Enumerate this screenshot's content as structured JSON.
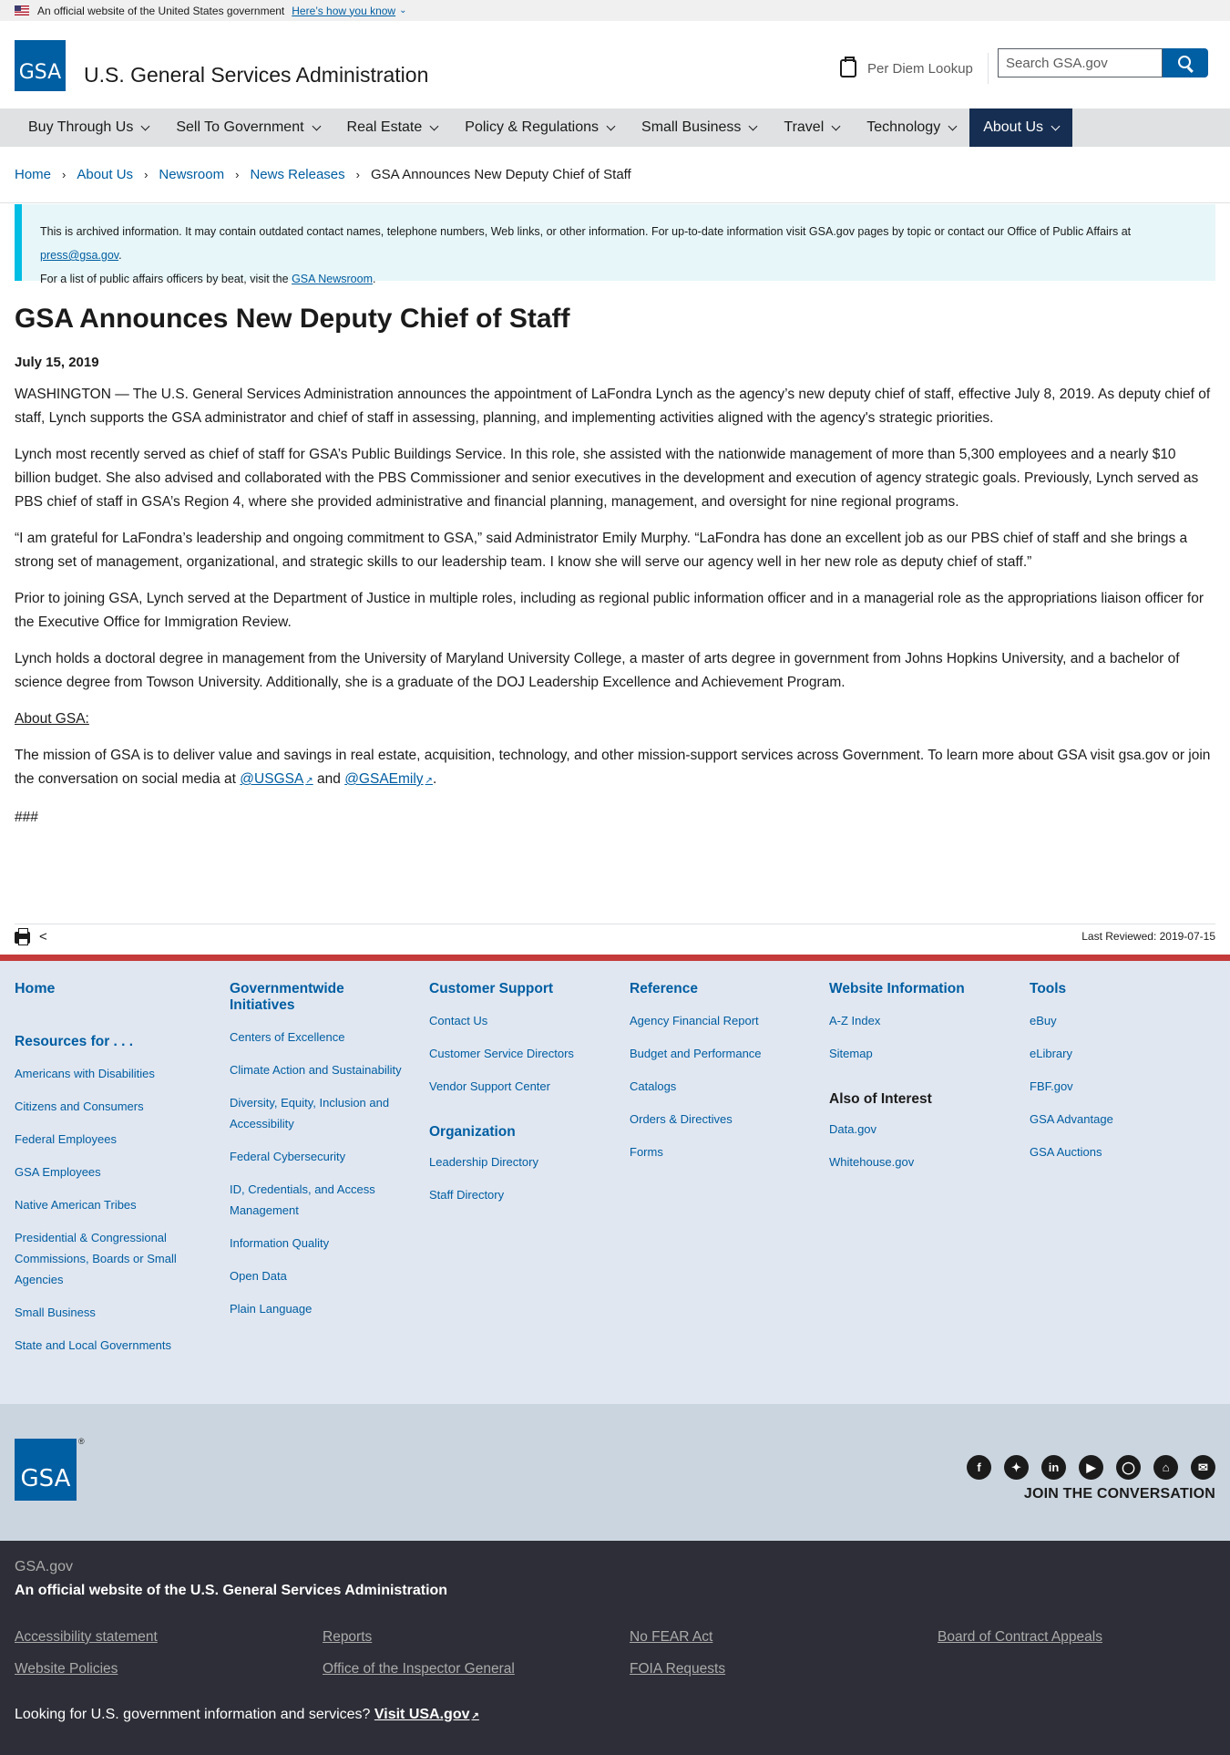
{
  "banner": {
    "text": "An official website of the United States government",
    "link": "Here’s how you know"
  },
  "header": {
    "logo": "GSA",
    "title": "U.S. General Services Administration",
    "per_diem": "Per Diem Lookup",
    "search_placeholder": "Search GSA.gov"
  },
  "nav": [
    {
      "label": "Buy Through Us"
    },
    {
      "label": "Sell To Government"
    },
    {
      "label": "Real Estate"
    },
    {
      "label": "Policy & Regulations"
    },
    {
      "label": "Small Business"
    },
    {
      "label": "Travel"
    },
    {
      "label": "Technology"
    },
    {
      "label": "About Us"
    }
  ],
  "breadcrumb": [
    "Home",
    "About Us",
    "Newsroom",
    "News Releases",
    "GSA Announces New Deputy Chief of Staff"
  ],
  "alert": {
    "line1": "This is archived information. It may contain outdated contact names, telephone numbers, Web links, or other information. For up-to-date information visit GSA.gov pages by topic or contact our Office of Public Affairs at",
    "email": "press@gsa.gov",
    "line2": "For a list of public affairs officers by beat, visit the",
    "newsroom": "GSA Newsroom"
  },
  "article": {
    "title": "GSA Announces New Deputy Chief of Staff",
    "date": "July 15, 2019",
    "p1": "WASHINGTON — The U.S. General Services Administration announces the appointment of LaFondra Lynch as the agency’s new deputy chief of staff, effective July 8, 2019. As deputy chief of staff, Lynch supports the GSA administrator and chief of staff in assessing, planning, and implementing activities aligned with the agency's strategic priorities.",
    "p2": "Lynch most recently served as chief of staff for GSA’s Public Buildings Service. In this role, she assisted with the nationwide management of more than 5,300 employees and a nearly $10 billion budget. She also advised and collaborated with the PBS Commissioner and senior executives in the development and execution of agency strategic goals. Previously, Lynch served as PBS chief of staff in GSA’s Region 4, where she provided administrative and financial planning, management, and oversight for nine regional programs.",
    "p3": "“I am grateful for LaFondra’s leadership and ongoing commitment to GSA,” said Administrator Emily Murphy. “LaFondra has done an excellent job as our PBS chief of staff and she brings a strong set of management, organizational, and strategic skills to our leadership team. I know she will serve our agency well in her new role as deputy chief of staff.”",
    "p4": "Prior to joining GSA, Lynch served at the Department of Justice in multiple roles, including as regional public information officer and in a managerial role as the appropriations liaison officer for the Executive Office for Immigration Review.",
    "p5": "Lynch holds a doctoral degree in management from the University of Maryland University College, a master of arts degree in government from Johns Hopkins University, and a bachelor of science degree from Towson University. Additionally, she is a graduate of the DOJ Leadership Excellence and Achievement Program.",
    "about_heading": "About GSA:",
    "p6_pre": "The mission of GSA is to deliver value and savings in real estate, acquisition, technology, and other mission-support services across Government. To learn more about GSA visit gsa.gov or join the conversation on social media at",
    "link_usgsa": "@USGSA",
    "and": "and",
    "link_gsaemily": "@GSAEmily",
    "end_mark": "###"
  },
  "page_tools": {
    "last_reviewed": "Last Reviewed: 2019-07-15"
  },
  "footer": {
    "home": "Home",
    "resources_heading": "Resources for . . .",
    "resources": [
      "Americans with Disabilities",
      "Citizens and Consumers",
      "Federal Employees",
      "GSA Employees",
      "Native American Tribes",
      "Presidential & Congressional Commissions, Boards or Small Agencies",
      "Small Business",
      "State and Local Governments"
    ],
    "governmentwide_heading": "Governmentwide Initiatives",
    "governmentwide": [
      "Centers of Excellence",
      "Climate Action and Sustainability",
      "Diversity, Equity, Inclusion and Accessibility",
      "Federal Cybersecurity",
      "ID, Credentials, and Access Management",
      "Information Quality",
      "Open Data",
      "Plain Language"
    ],
    "customer_heading": "Customer Support",
    "customer": [
      "Contact Us",
      "Customer Service Directors",
      "Vendor Support Center"
    ],
    "organization_heading": "Organization",
    "organization": [
      "Leadership Directory",
      "Staff Directory"
    ],
    "reference_heading": "Reference",
    "reference": [
      "Agency Financial Report",
      "Budget and Performance",
      "Catalogs",
      "Orders & Directives",
      "Forms"
    ],
    "website_heading": "Website Information",
    "website": [
      "A-Z Index",
      "Sitemap"
    ],
    "interest_heading": "Also of Interest",
    "interest": [
      "Data.gov",
      "Whitehouse.gov"
    ],
    "tools_heading": "Tools",
    "tools": [
      "eBuy",
      "eLibrary",
      "FBF.gov",
      "GSA Advantage",
      "GSA Auctions"
    ]
  },
  "footer_secondary": {
    "logo": "GSA",
    "registered": "®",
    "join": "JOIN THE CONVERSATION",
    "social_icons": [
      "facebook-icon",
      "twitter-icon",
      "linkedin-icon",
      "youtube-icon",
      "instagram-icon",
      "blog-icon",
      "email-icon"
    ]
  },
  "identifier": {
    "domain": "GSA.gov",
    "title": "An official website of the U.S. General Services Administration",
    "links": [
      "Accessibility statement",
      "Reports",
      "No FEAR Act",
      "Board of Contract Appeals",
      "Website Policies",
      "Office of the Inspector General",
      "FOIA Requests"
    ],
    "usa_text": "Looking for U.S. government information and services?",
    "usa_link": "Visit USA.gov"
  },
  "colors": {
    "primary": "#005ea2",
    "nav_active": "#162e51",
    "alert_border": "#00bde3",
    "footer_bg": "#e1e7f1",
    "identifier_bg": "#2d2e37"
  }
}
